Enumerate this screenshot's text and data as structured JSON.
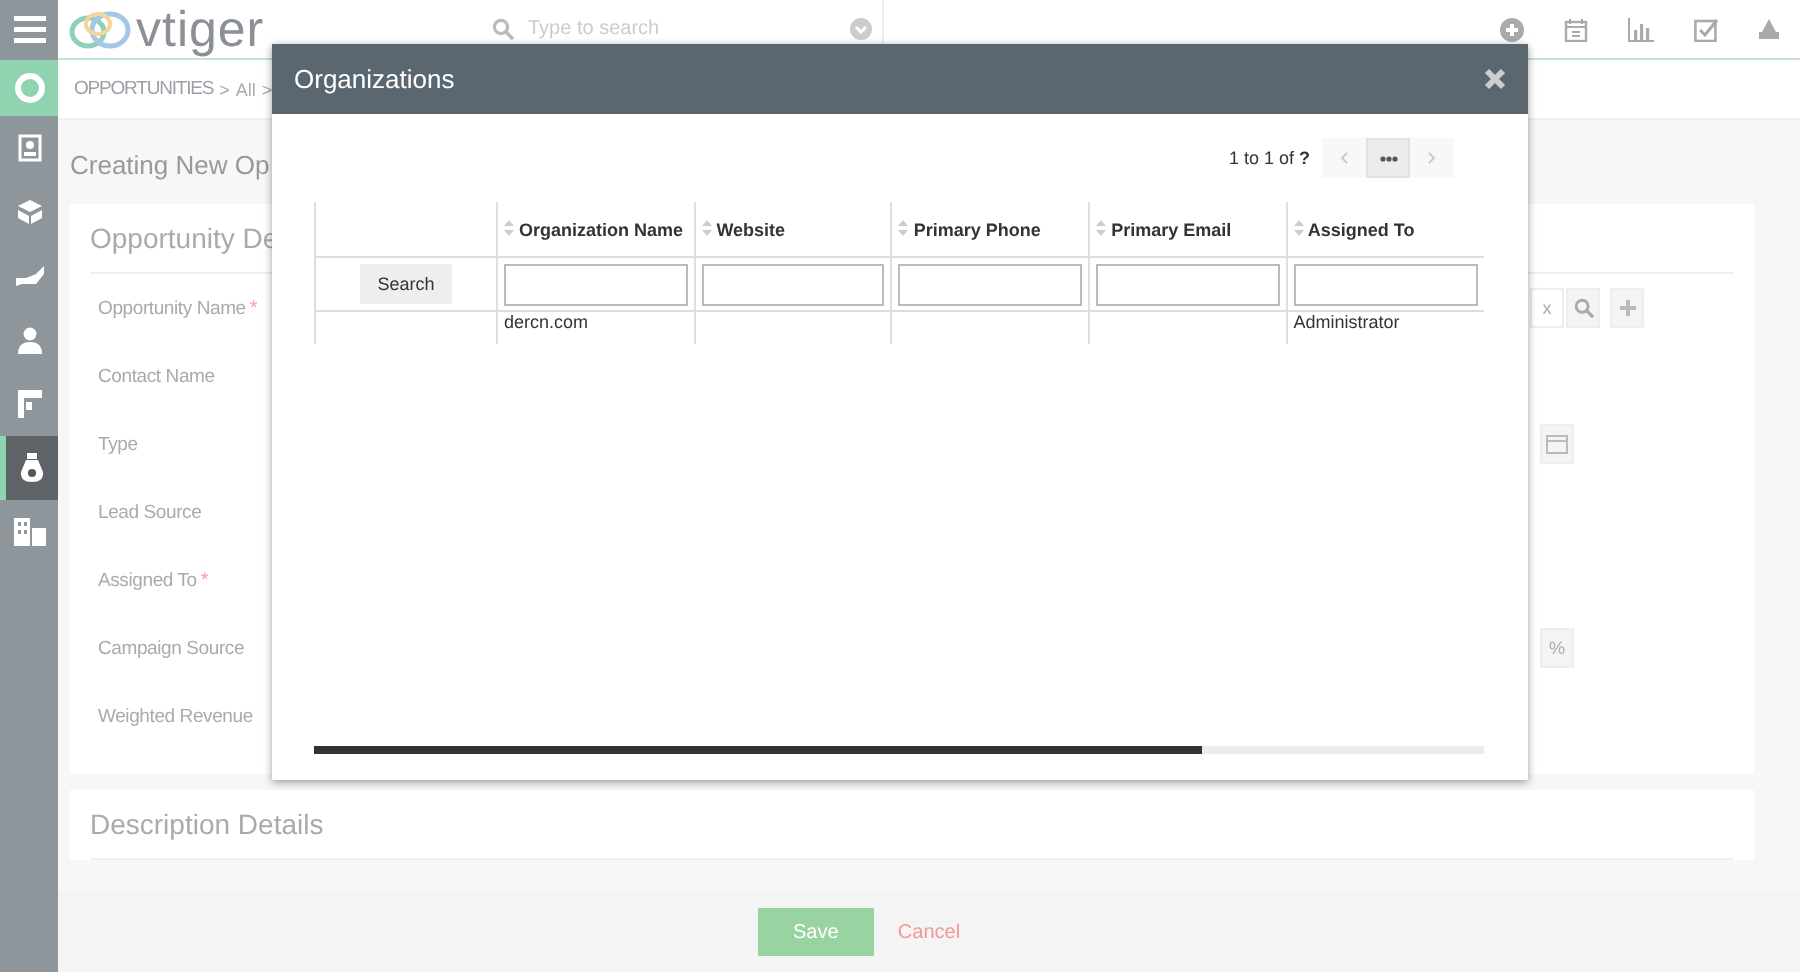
{
  "header": {
    "logo": "vtiger",
    "search_placeholder": "Type to search",
    "icons": [
      {
        "kind": "plus"
      },
      {
        "kind": "calendar"
      },
      {
        "kind": "chart"
      },
      {
        "kind": "task"
      },
      {
        "kind": "user"
      }
    ]
  },
  "sidebar": [
    {
      "kind": "menu",
      "selected": false
    },
    {
      "kind": "app",
      "selected": false
    },
    {
      "kind": "card",
      "selected": false
    },
    {
      "kind": "box",
      "selected": false
    },
    {
      "kind": "hand",
      "selected": false
    },
    {
      "kind": "user",
      "selected": false
    },
    {
      "kind": "phone",
      "selected": false
    },
    {
      "kind": "bag",
      "selected": true
    },
    {
      "kind": "building",
      "selected": false
    }
  ],
  "breadcrumb": {
    "module": "OPPORTUNITIES",
    "separator": ">",
    "view": "All"
  },
  "page_title": "Creating New Op",
  "section": {
    "title": "Opportunity De",
    "required_mark": "*",
    "fields": [
      {
        "label": "Opportunity Name",
        "required": true,
        "kind": "reference",
        "clear": "x"
      },
      {
        "label": "Contact Name",
        "required": false,
        "kind": "text"
      },
      {
        "label": "Type",
        "required": false,
        "kind": "date"
      },
      {
        "label": "Lead Source",
        "required": false,
        "kind": "text"
      },
      {
        "label": "Assigned To",
        "required": true,
        "kind": "text"
      },
      {
        "label": "Campaign Source",
        "required": false,
        "kind": "percent",
        "unit": "%"
      },
      {
        "label": "Weighted Revenue",
        "required": false,
        "kind": "text"
      }
    ]
  },
  "description_title": "Description Details",
  "footer": {
    "save": "Save",
    "cancel": "Cancel"
  },
  "modal": {
    "title": "Organizations",
    "pagination": "1 to 1  of **?**",
    "columns": [
      "Organization Name",
      "Website",
      "Primary Phone",
      "Primary Email",
      "Assigned To"
    ],
    "search_button": "Search",
    "rows": [
      [
        "dercn.com",
        "",
        "",
        "",
        "Administrator"
      ]
    ]
  }
}
